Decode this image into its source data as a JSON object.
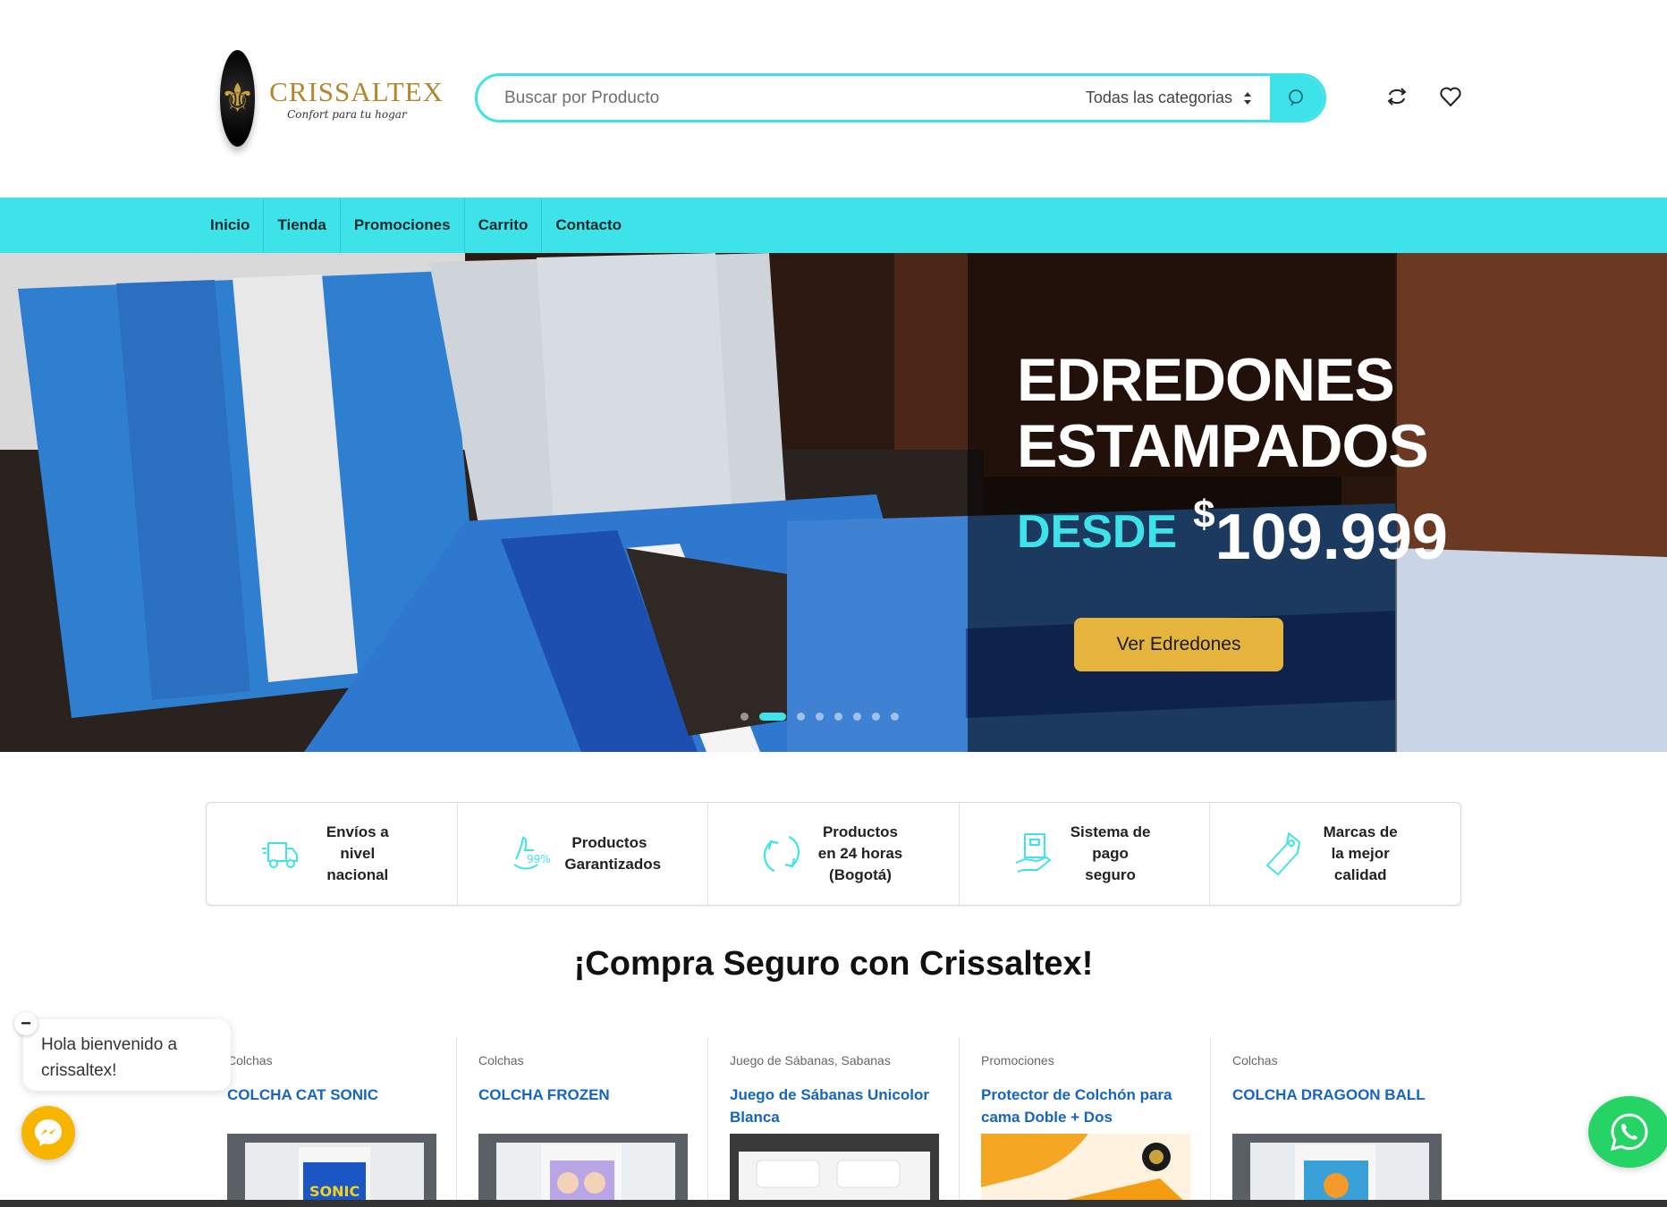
{
  "brand": {
    "name": "CRISSALTEX",
    "tagline": "Confort para tu hogar"
  },
  "search": {
    "placeholder": "Buscar por Producto",
    "category": "Todas las categorias"
  },
  "header_icons": [
    "compare-icon",
    "heart-icon"
  ],
  "nav": {
    "items": [
      "Inicio",
      "Tienda",
      "Promociones",
      "Carrito",
      "Contacto"
    ]
  },
  "hero": {
    "title_line1": "EDREDONES",
    "title_line2": "ESTAMPADOS",
    "desde": "DESDE",
    "currency": "$",
    "price": "109.999",
    "cta": "Ver Edredones",
    "slides": 8,
    "active_slide": 1
  },
  "features": [
    {
      "icon": "truck-icon",
      "text": "Envíos a nivel nacional"
    },
    {
      "icon": "guarantee-icon",
      "text": "Productos Garantizados"
    },
    {
      "icon": "refresh-icon",
      "text": "Productos en 24 horas (Bogotá)"
    },
    {
      "icon": "secure-payment-icon",
      "text": "Sistema de pago seguro"
    },
    {
      "icon": "tag-icon",
      "text": "Marcas de la mejor calidad"
    }
  ],
  "section_title": "¡Compra Seguro con Crissaltex!",
  "products": [
    {
      "category": "Colchas",
      "name": "COLCHA CAT SONIC"
    },
    {
      "category": "Colchas",
      "name": "COLCHA FROZEN"
    },
    {
      "category": "Juego de Sábanas, Sabanas",
      "name": "Juego de Sábanas Unicolor Blanca"
    },
    {
      "category": "Promociones",
      "name": "Protector de Colchón para cama Doble + Dos Almohadas"
    },
    {
      "category": "Colchas",
      "name": "COLCHA DRAGOON BALL"
    }
  ],
  "chat": {
    "message": "Hola bienvenido a crissaltex!"
  },
  "colors": {
    "accent": "#3ee3ea",
    "cta": "#e5b43c",
    "link": "#1565c0",
    "whatsapp": "#26d365",
    "messenger": "#f7b500"
  }
}
